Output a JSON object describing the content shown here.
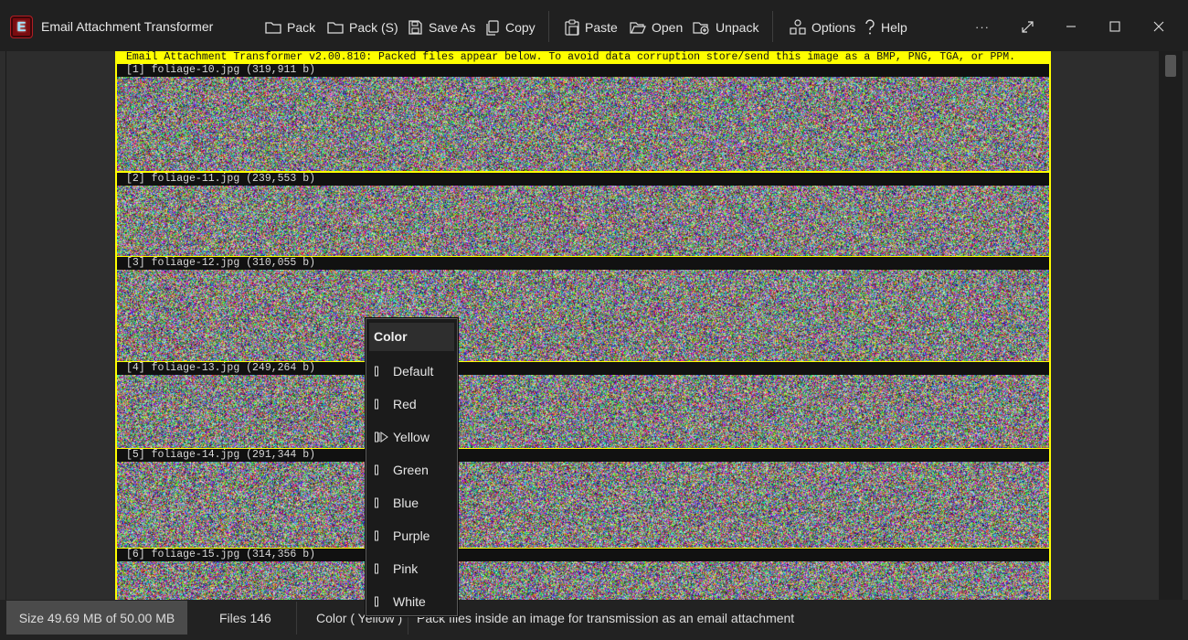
{
  "window": {
    "title": "Email Attachment Transformer",
    "icon_letter": "E"
  },
  "toolbar": {
    "pack": "Pack",
    "pack_s": "Pack (S)",
    "save_as": "Save As",
    "copy": "Copy",
    "paste": "Paste",
    "open": "Open",
    "unpack": "Unpack",
    "options": "Options",
    "help": "Help",
    "more": "···"
  },
  "image": {
    "header": "Email Attachment Transformer v2.00.810: Packed files appear below. To avoid data corruption store/send this image as a BMP, PNG, TGA, or PPM.",
    "frame_color": "#ffff00",
    "files": [
      {
        "label": "[1] foliage-10.jpg (319,911 b)"
      },
      {
        "label": "[2] foliage-11.jpg (239,553 b)"
      },
      {
        "label": "[3] foliage-12.jpg (310,055 b)"
      },
      {
        "label": "[4] foliage-13.jpg (249,264 b)"
      },
      {
        "label": "[5] foliage-14.jpg (291,344 b)"
      },
      {
        "label": "[6] foliage-15.jpg (314,356 b)"
      }
    ]
  },
  "color_menu": {
    "title": "Color",
    "selected": "Yellow",
    "items": [
      "Default",
      "Red",
      "Yellow",
      "Green",
      "Blue",
      "Purple",
      "Pink",
      "White"
    ]
  },
  "status": {
    "size": "Size 49.69 MB of 50.00 MB",
    "files": "Files 146",
    "color": "Color ( Yellow )",
    "description": "Pack files inside an image for transmission as an email attachment"
  },
  "icons": {
    "app": "app-logo-icon",
    "pack": "folder-icon",
    "pack_s": "folder-icon",
    "save_as": "save-icon",
    "copy": "copy-icon",
    "paste": "paste-icon",
    "open": "folder-open-icon",
    "unpack": "unpack-icon",
    "options": "options-icon",
    "help": "help-icon"
  }
}
